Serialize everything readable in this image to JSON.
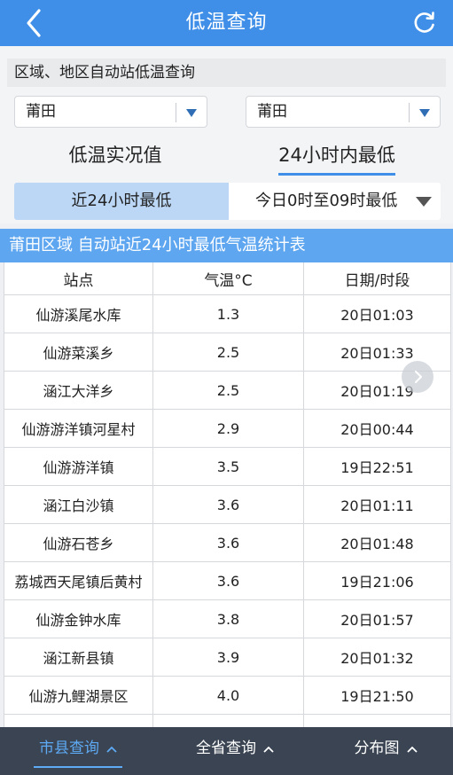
{
  "header": {
    "title": "低温查询"
  },
  "region_title": "区域、地区自动站低温查询",
  "selects": {
    "left_value": "莆田",
    "right_value": "莆田"
  },
  "toggles": {
    "realtime": "低温实况值",
    "min24": "24小时内最低"
  },
  "segments": {
    "left": "近24小时最低",
    "right": "今日0时至09时最低"
  },
  "table": {
    "title": "莆田区域 自动站近24小时最低气温统计表",
    "columns": [
      "站点",
      "气温°C",
      "日期/时段"
    ],
    "rows": [
      [
        "仙游溪尾水库",
        "1.3",
        "20日01:03"
      ],
      [
        "仙游菜溪乡",
        "2.5",
        "20日01:33"
      ],
      [
        "涵江大洋乡",
        "2.5",
        "20日01:19"
      ],
      [
        "仙游游洋镇河星村",
        "2.9",
        "20日00:44"
      ],
      [
        "仙游游洋镇",
        "3.5",
        "19日22:51"
      ],
      [
        "涵江白沙镇",
        "3.6",
        "20日01:11"
      ],
      [
        "仙游石苍乡",
        "3.6",
        "20日01:48"
      ],
      [
        "荔城西天尾镇后黄村",
        "3.6",
        "19日21:06"
      ],
      [
        "仙游金钟水库",
        "3.8",
        "20日01:57"
      ],
      [
        "涵江新县镇",
        "3.9",
        "20日01:32"
      ],
      [
        "仙游九鲤湖景区",
        "4.0",
        "19日21:50"
      ]
    ]
  },
  "tabbar": {
    "tabs": [
      "市县查询",
      "全省查询",
      "分布图"
    ]
  },
  "colors": {
    "header": "#3f8fe8",
    "accent": "#5eaaf5",
    "tabbar": "#3a4452"
  },
  "icons": {
    "back": "chevron-left-icon",
    "refresh": "refresh-icon"
  }
}
